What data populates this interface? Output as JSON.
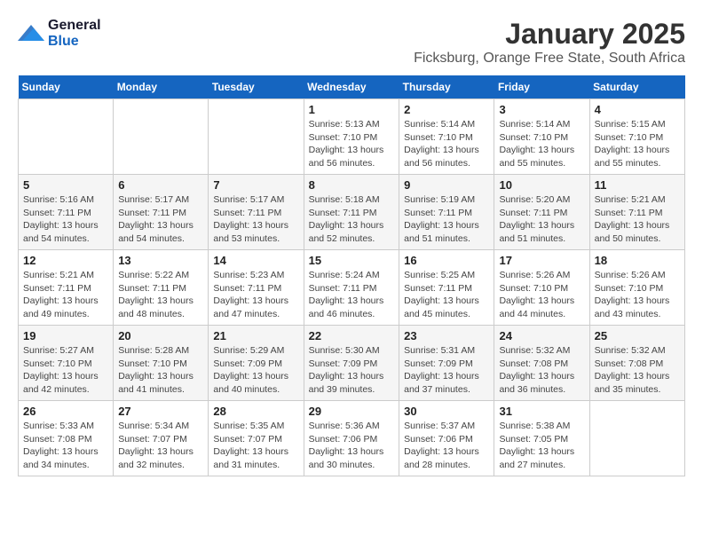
{
  "header": {
    "logo_line1": "General",
    "logo_line2": "Blue",
    "title": "January 2025",
    "subtitle": "Ficksburg, Orange Free State, South Africa"
  },
  "days_of_week": [
    "Sunday",
    "Monday",
    "Tuesday",
    "Wednesday",
    "Thursday",
    "Friday",
    "Saturday"
  ],
  "weeks": [
    [
      {
        "day": "",
        "info": ""
      },
      {
        "day": "",
        "info": ""
      },
      {
        "day": "",
        "info": ""
      },
      {
        "day": "1",
        "info": "Sunrise: 5:13 AM\nSunset: 7:10 PM\nDaylight: 13 hours and 56 minutes."
      },
      {
        "day": "2",
        "info": "Sunrise: 5:14 AM\nSunset: 7:10 PM\nDaylight: 13 hours and 56 minutes."
      },
      {
        "day": "3",
        "info": "Sunrise: 5:14 AM\nSunset: 7:10 PM\nDaylight: 13 hours and 55 minutes."
      },
      {
        "day": "4",
        "info": "Sunrise: 5:15 AM\nSunset: 7:10 PM\nDaylight: 13 hours and 55 minutes."
      }
    ],
    [
      {
        "day": "5",
        "info": "Sunrise: 5:16 AM\nSunset: 7:11 PM\nDaylight: 13 hours and 54 minutes."
      },
      {
        "day": "6",
        "info": "Sunrise: 5:17 AM\nSunset: 7:11 PM\nDaylight: 13 hours and 54 minutes."
      },
      {
        "day": "7",
        "info": "Sunrise: 5:17 AM\nSunset: 7:11 PM\nDaylight: 13 hours and 53 minutes."
      },
      {
        "day": "8",
        "info": "Sunrise: 5:18 AM\nSunset: 7:11 PM\nDaylight: 13 hours and 52 minutes."
      },
      {
        "day": "9",
        "info": "Sunrise: 5:19 AM\nSunset: 7:11 PM\nDaylight: 13 hours and 51 minutes."
      },
      {
        "day": "10",
        "info": "Sunrise: 5:20 AM\nSunset: 7:11 PM\nDaylight: 13 hours and 51 minutes."
      },
      {
        "day": "11",
        "info": "Sunrise: 5:21 AM\nSunset: 7:11 PM\nDaylight: 13 hours and 50 minutes."
      }
    ],
    [
      {
        "day": "12",
        "info": "Sunrise: 5:21 AM\nSunset: 7:11 PM\nDaylight: 13 hours and 49 minutes."
      },
      {
        "day": "13",
        "info": "Sunrise: 5:22 AM\nSunset: 7:11 PM\nDaylight: 13 hours and 48 minutes."
      },
      {
        "day": "14",
        "info": "Sunrise: 5:23 AM\nSunset: 7:11 PM\nDaylight: 13 hours and 47 minutes."
      },
      {
        "day": "15",
        "info": "Sunrise: 5:24 AM\nSunset: 7:11 PM\nDaylight: 13 hours and 46 minutes."
      },
      {
        "day": "16",
        "info": "Sunrise: 5:25 AM\nSunset: 7:11 PM\nDaylight: 13 hours and 45 minutes."
      },
      {
        "day": "17",
        "info": "Sunrise: 5:26 AM\nSunset: 7:10 PM\nDaylight: 13 hours and 44 minutes."
      },
      {
        "day": "18",
        "info": "Sunrise: 5:26 AM\nSunset: 7:10 PM\nDaylight: 13 hours and 43 minutes."
      }
    ],
    [
      {
        "day": "19",
        "info": "Sunrise: 5:27 AM\nSunset: 7:10 PM\nDaylight: 13 hours and 42 minutes."
      },
      {
        "day": "20",
        "info": "Sunrise: 5:28 AM\nSunset: 7:10 PM\nDaylight: 13 hours and 41 minutes."
      },
      {
        "day": "21",
        "info": "Sunrise: 5:29 AM\nSunset: 7:09 PM\nDaylight: 13 hours and 40 minutes."
      },
      {
        "day": "22",
        "info": "Sunrise: 5:30 AM\nSunset: 7:09 PM\nDaylight: 13 hours and 39 minutes."
      },
      {
        "day": "23",
        "info": "Sunrise: 5:31 AM\nSunset: 7:09 PM\nDaylight: 13 hours and 37 minutes."
      },
      {
        "day": "24",
        "info": "Sunrise: 5:32 AM\nSunset: 7:08 PM\nDaylight: 13 hours and 36 minutes."
      },
      {
        "day": "25",
        "info": "Sunrise: 5:32 AM\nSunset: 7:08 PM\nDaylight: 13 hours and 35 minutes."
      }
    ],
    [
      {
        "day": "26",
        "info": "Sunrise: 5:33 AM\nSunset: 7:08 PM\nDaylight: 13 hours and 34 minutes."
      },
      {
        "day": "27",
        "info": "Sunrise: 5:34 AM\nSunset: 7:07 PM\nDaylight: 13 hours and 32 minutes."
      },
      {
        "day": "28",
        "info": "Sunrise: 5:35 AM\nSunset: 7:07 PM\nDaylight: 13 hours and 31 minutes."
      },
      {
        "day": "29",
        "info": "Sunrise: 5:36 AM\nSunset: 7:06 PM\nDaylight: 13 hours and 30 minutes."
      },
      {
        "day": "30",
        "info": "Sunrise: 5:37 AM\nSunset: 7:06 PM\nDaylight: 13 hours and 28 minutes."
      },
      {
        "day": "31",
        "info": "Sunrise: 5:38 AM\nSunset: 7:05 PM\nDaylight: 13 hours and 27 minutes."
      },
      {
        "day": "",
        "info": ""
      }
    ]
  ]
}
